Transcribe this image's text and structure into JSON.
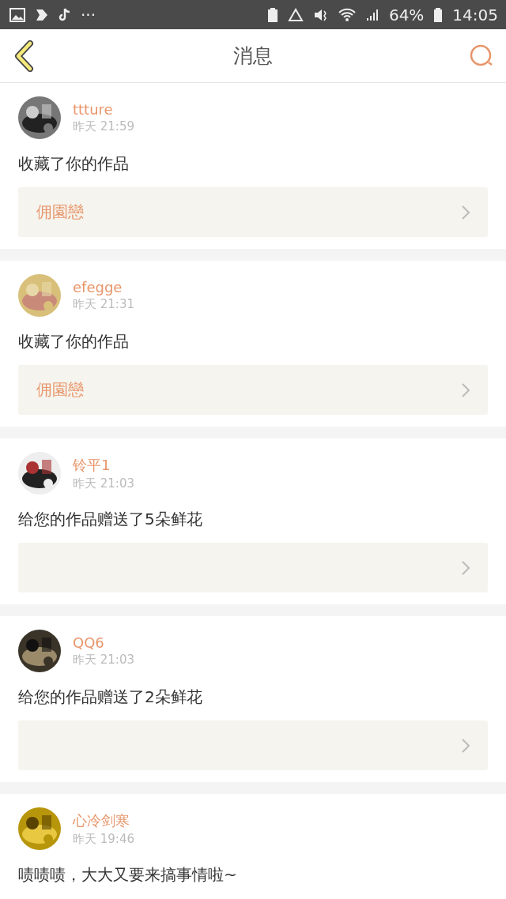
{
  "status_bar": {
    "more": "···",
    "battery": "64%",
    "time": "14:05"
  },
  "header": {
    "title": "消息"
  },
  "messages": [
    {
      "user": "ttture",
      "time": "昨天 21:59",
      "text": "收藏了你的作品",
      "work": {
        "kind": "titled",
        "title": "佣園戀"
      }
    },
    {
      "user": "efegge",
      "time": "昨天 21:31",
      "text": "收藏了你的作品",
      "work": {
        "kind": "titled",
        "title": "佣園戀"
      }
    },
    {
      "user": "铃平1",
      "time": "昨天 21:03",
      "text": "给您的作品赠送了5朵鲜花",
      "work": {
        "kind": "untitled"
      }
    },
    {
      "user": "QQ6",
      "time": "昨天 21:03",
      "text": "给您的作品赠送了2朵鲜花",
      "work": {
        "kind": "untitled"
      }
    },
    {
      "user": "心冷剑寒",
      "time": "昨天 19:46",
      "text": "啧啧啧，大大又要来搞事情啦~"
    }
  ]
}
